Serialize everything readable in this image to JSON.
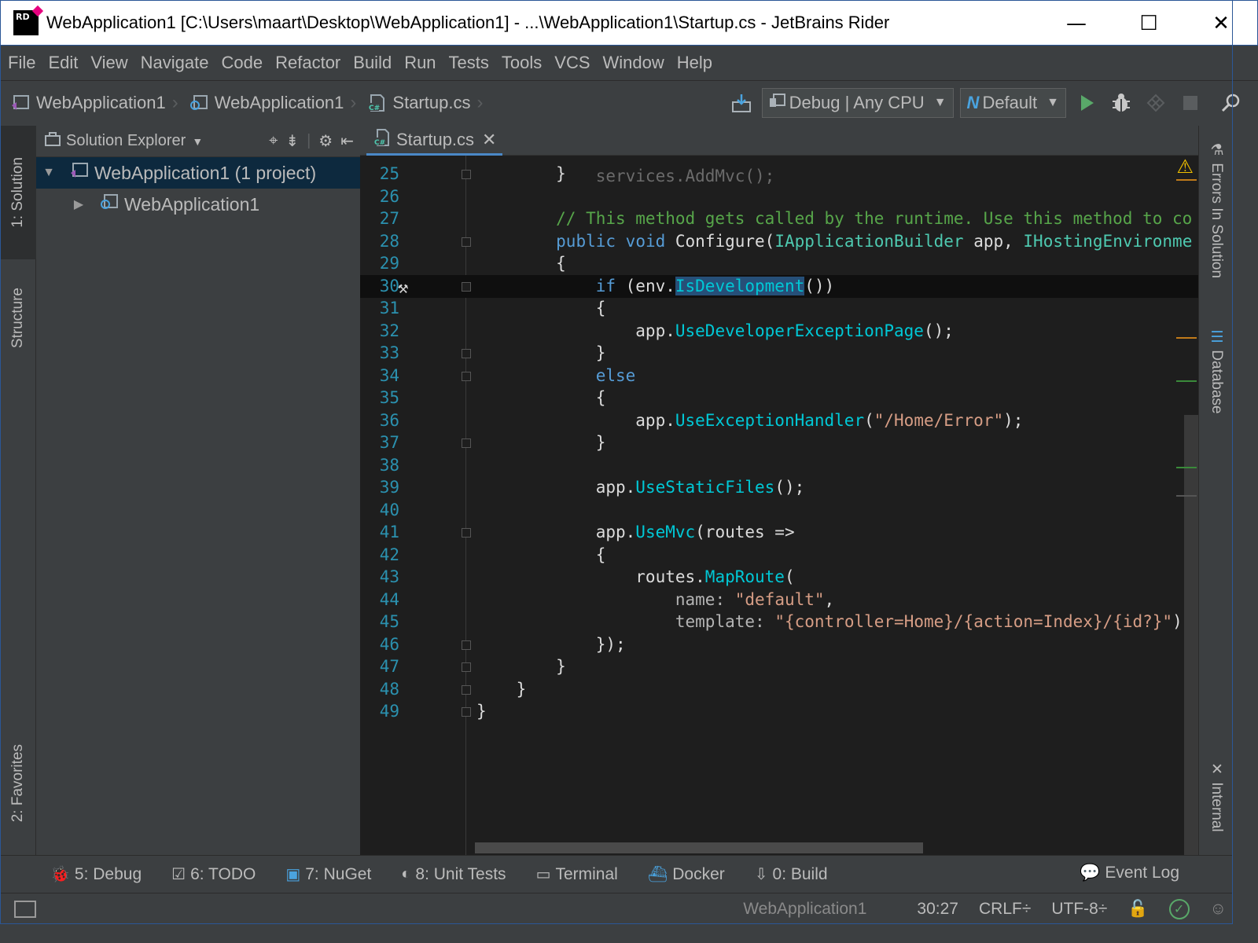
{
  "window": {
    "title": "WebApplication1 [C:\\Users\\maart\\Desktop\\WebApplication1] - ...\\WebApplication1\\Startup.cs - JetBrains Rider",
    "app_icon_text": "RD",
    "minimize": "—",
    "maximize": "☐",
    "close": "✕"
  },
  "menu": [
    "File",
    "Edit",
    "View",
    "Navigate",
    "Code",
    "Refactor",
    "Build",
    "Run",
    "Tests",
    "Tools",
    "VCS",
    "Window",
    "Help"
  ],
  "breadcrumbs": [
    "WebApplication1",
    "WebApplication1",
    "Startup.cs"
  ],
  "toolbar": {
    "config": "Debug | Any CPU",
    "runtime": "Default"
  },
  "left_stripe": {
    "solution": "1: Solution",
    "structure": "Structure",
    "favorites": "2: Favorites"
  },
  "solution_explorer": {
    "title": "Solution Explorer",
    "items": [
      {
        "label": "WebApplication1 (1 project)",
        "expanded": true,
        "selected": true
      },
      {
        "label": "WebApplication1",
        "expanded": false,
        "selected": false
      }
    ]
  },
  "editor": {
    "tab_label": "Startup.cs",
    "current_line": 30,
    "lines": [
      {
        "n": "25",
        "text": "        }"
      },
      {
        "n": "26",
        "text": ""
      },
      {
        "n": "27",
        "text": "        // This method gets called by the runtime. Use this method to co"
      },
      {
        "n": "28",
        "text": "        public void Configure(IApplicationBuilder app, IHostingEnvironme"
      },
      {
        "n": "29",
        "text": "        {"
      },
      {
        "n": "30",
        "text": "            if (env.IsDevelopment())"
      },
      {
        "n": "31",
        "text": "            {"
      },
      {
        "n": "32",
        "text": "                app.UseDeveloperExceptionPage();"
      },
      {
        "n": "33",
        "text": "            }"
      },
      {
        "n": "34",
        "text": "            else"
      },
      {
        "n": "35",
        "text": "            {"
      },
      {
        "n": "36",
        "text": "                app.UseExceptionHandler(\"/Home/Error\");"
      },
      {
        "n": "37",
        "text": "            }"
      },
      {
        "n": "38",
        "text": ""
      },
      {
        "n": "39",
        "text": "            app.UseStaticFiles();"
      },
      {
        "n": "40",
        "text": ""
      },
      {
        "n": "41",
        "text": "            app.UseMvc(routes =>"
      },
      {
        "n": "42",
        "text": "            {"
      },
      {
        "n": "43",
        "text": "                routes.MapRoute("
      },
      {
        "n": "44",
        "text": "                    name: \"default\","
      },
      {
        "n": "45",
        "text": "                    template: \"{controller=Home}/{action=Index}/{id?}\");"
      },
      {
        "n": "46",
        "text": "            });"
      },
      {
        "n": "47",
        "text": "        }"
      },
      {
        "n": "48",
        "text": "    }"
      },
      {
        "n": "49",
        "text": "}"
      }
    ]
  },
  "right_stripe": {
    "errors": "Errors In Solution",
    "database": "Database",
    "internal": "Internal"
  },
  "bottom_tools": [
    {
      "label": "5: Debug",
      "icon": "bug-icon"
    },
    {
      "label": "6: TODO",
      "icon": "todo-icon"
    },
    {
      "label": "7: NuGet",
      "icon": "nuget-icon"
    },
    {
      "label": "8: Unit Tests",
      "icon": "unit-tests-icon"
    },
    {
      "label": "Terminal",
      "icon": "terminal-icon"
    },
    {
      "label": "Docker",
      "icon": "docker-icon"
    },
    {
      "label": "0: Build",
      "icon": "build-icon"
    }
  ],
  "event_log": "Event Log",
  "status": {
    "project": "WebApplication1",
    "position": "30:27",
    "line_sep": "CRLF÷",
    "encoding": "UTF-8÷"
  },
  "colors": {
    "keyword": "#569cd6",
    "comment": "#57a64a",
    "method": "#00c8d6",
    "string": "#d69d85",
    "type": "#4ec9b0",
    "line_number": "#2b91af"
  }
}
